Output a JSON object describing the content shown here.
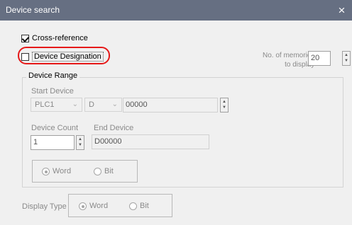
{
  "title": "Device search",
  "close_icon": "×",
  "cross_reference": {
    "label": "Cross-reference",
    "checked": true
  },
  "device_designation": {
    "label": "Device Designation",
    "checked": false
  },
  "memories": {
    "line1": "No. of memories",
    "line2": "to display",
    "value": "20"
  },
  "device_range": {
    "title": "Device Range",
    "start_device_label": "Start Device",
    "plc": "PLC1",
    "device_type": "D",
    "start_value": "00000",
    "device_count_label": "Device Count",
    "device_count_value": "1",
    "end_device_label": "End Device",
    "end_device_value": "D00000",
    "word": "Word",
    "bit": "Bit"
  },
  "display_type": {
    "label": "Display Type",
    "word": "Word",
    "bit": "Bit"
  },
  "icons": {
    "chevron": "⌄",
    "up": "▲",
    "down": "▼"
  }
}
